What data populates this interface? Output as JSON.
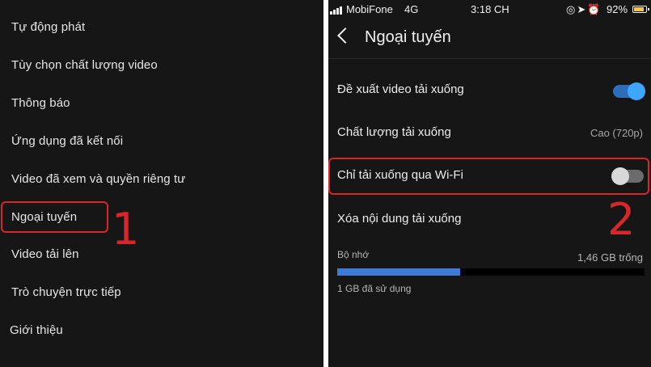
{
  "left_menu": {
    "items": [
      "Tự động phát",
      "Tùy chọn chất lượng video",
      "Thông báo",
      "Ứng dụng đã kết nối",
      "Video đã xem và quyền riêng tư",
      "Ngoại tuyến",
      "Video tải lên",
      "Trò chuyện trực tiếp",
      "Giới thiệu"
    ],
    "annotation_number": "1"
  },
  "status_bar": {
    "carrier": "MobiFone",
    "network": "4G",
    "time": "3:18 CH",
    "battery": "92%"
  },
  "screen": {
    "title": "Ngoại tuyến",
    "settings": {
      "recommend_label": "Đề xuất video tải xuống",
      "recommend_enabled": true,
      "quality_label": "Chất lượng tải xuống",
      "quality_value": "Cao (720p)",
      "wifi_only_label": "Chỉ tải xuống qua Wi-Fi",
      "wifi_only_enabled": false,
      "delete_label": "Xóa nội dung tải xuống"
    },
    "storage": {
      "label": "Bộ nhớ",
      "free": "1,46 GB trống",
      "used": "1 GB đã sử dụng",
      "used_fraction": 0.4
    },
    "annotation_number": "2"
  },
  "colors": {
    "annotation": "#d8262b",
    "accent": "#3ea6ff",
    "background": "#161616"
  }
}
